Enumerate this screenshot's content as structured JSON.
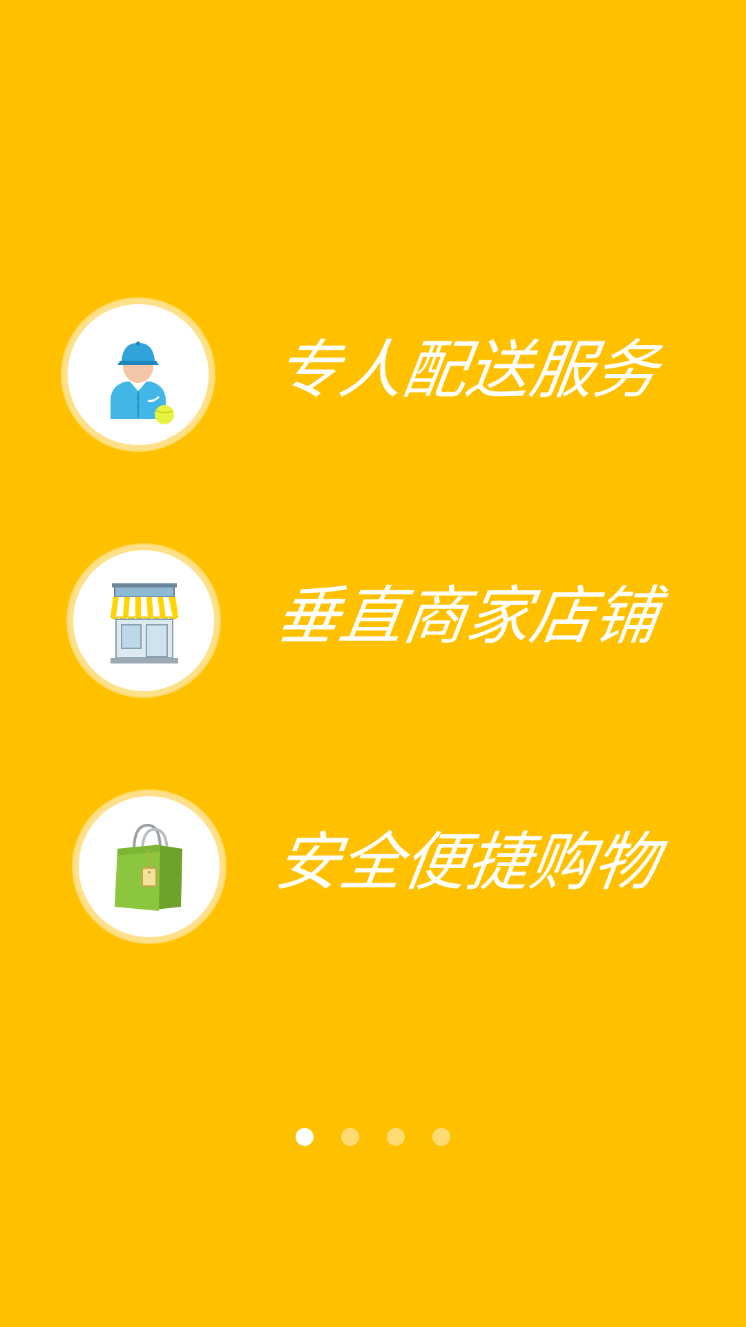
{
  "features": [
    {
      "label": "专人配送服务",
      "icon": "delivery-person-icon"
    },
    {
      "label": "垂直商家店铺",
      "icon": "storefront-icon"
    },
    {
      "label": "安全便捷购物",
      "icon": "shopping-bag-icon"
    }
  ],
  "pager": {
    "total": 4,
    "active": 1
  },
  "colors": {
    "background": "#FFC000",
    "circle_border": "#FFE08A",
    "text": "#FFFFFF"
  }
}
